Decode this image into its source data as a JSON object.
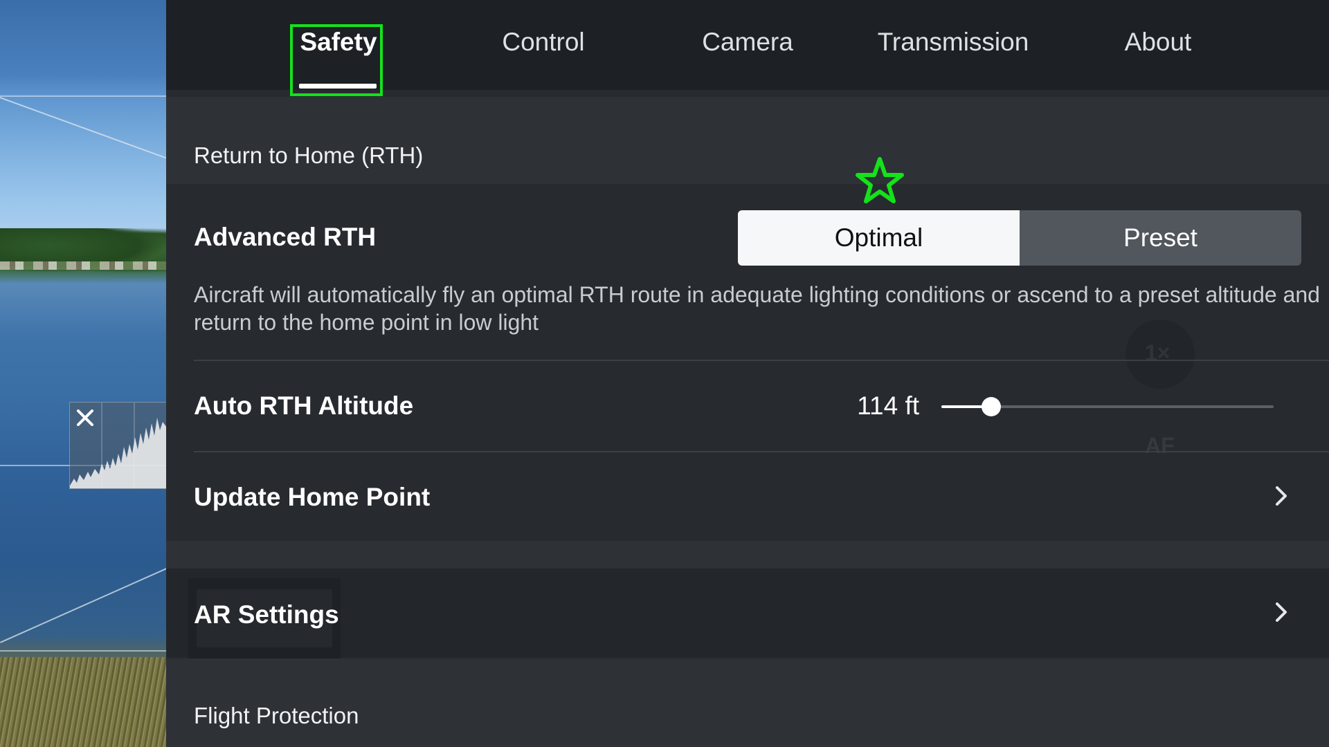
{
  "tabs": [
    {
      "label": "Safety",
      "active": true
    },
    {
      "label": "Control",
      "active": false
    },
    {
      "label": "Camera",
      "active": false
    },
    {
      "label": "Transmission",
      "active": false
    },
    {
      "label": "About",
      "active": false
    }
  ],
  "sections": {
    "rth": {
      "header": "Return to Home (RTH)",
      "advanced_rth": {
        "label": "Advanced RTH",
        "options": [
          "Optimal",
          "Preset"
        ],
        "selected": "Optimal",
        "description": "Aircraft will automatically fly an optimal RTH route in adequate lighting conditions or ascend to a preset altitude and return to the home point in low light"
      },
      "auto_rth_altitude": {
        "label": "Auto RTH Altitude",
        "value_text": "114 ft",
        "slider_fraction": 0.15
      },
      "update_home_point": {
        "label": "Update Home Point"
      }
    },
    "ar_settings": {
      "label": "AR Settings"
    },
    "flight_protection": {
      "header": "Flight Protection"
    }
  },
  "ghost": {
    "zoom": "1×",
    "af": "AF"
  },
  "icons": {
    "histogram_close": "close-icon",
    "chevron": "chevron-right-icon",
    "marker": "star-marker-icon"
  },
  "colors": {
    "highlight": "#14e21a",
    "panel_bg": "#272b30",
    "tabbar_bg": "#1d2024",
    "segment_selected_bg": "#f6f7f8"
  }
}
